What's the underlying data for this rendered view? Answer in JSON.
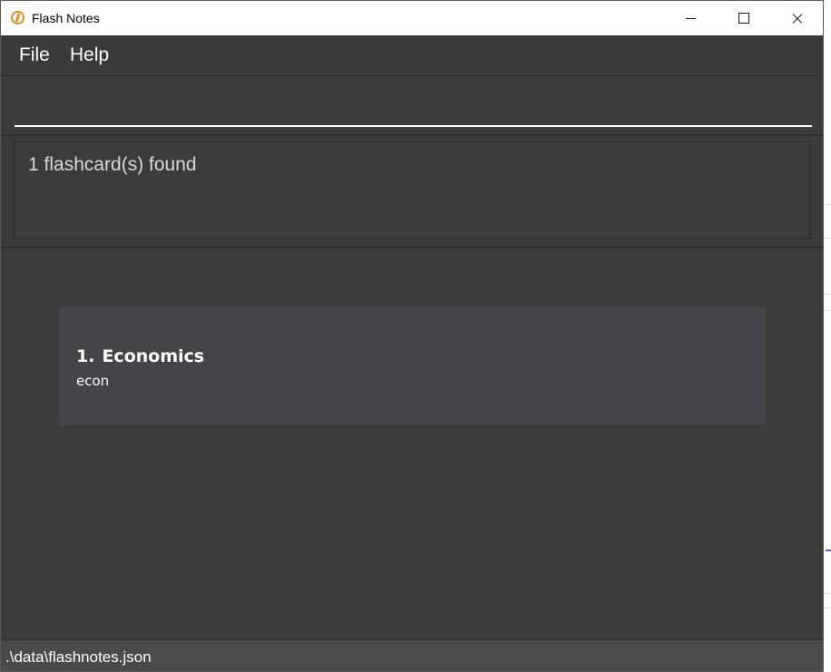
{
  "window": {
    "title": "Flash Notes"
  },
  "menu": {
    "file": "File",
    "help": "Help"
  },
  "command": {
    "value": "",
    "placeholder": ""
  },
  "result": {
    "message": "1 flashcard(s) found"
  },
  "flashcards": [
    {
      "index": "1.",
      "name": "Economics",
      "tag": "econ"
    }
  ],
  "status": {
    "file_path": ".\\data\\flashnotes.json"
  },
  "icons": {
    "app": "flash-notes-logo-icon",
    "minimize": "minimize-icon",
    "maximize": "maximize-icon",
    "close": "close-icon"
  },
  "colors": {
    "background": "#3b3b3b",
    "card": "#444548",
    "statusbar": "#4a4a4a",
    "accent": "#e8891c"
  }
}
